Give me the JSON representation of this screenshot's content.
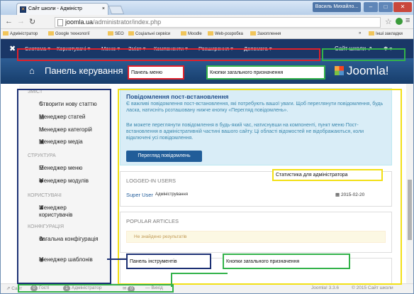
{
  "browser": {
    "tab_title": "Сайт школи - Адміністр",
    "tab_close": "×",
    "user_name": "Василь Михайло...",
    "url_host": "joomla.ua",
    "url_path": "/administrator/index.php",
    "bookmarks": [
      "Адміністратор",
      "Google технології",
      "SEO",
      "Соціальні сервіси",
      "Moodle",
      "Web-розробка",
      "Захоплення"
    ],
    "bookmarks_more": "»",
    "other_bookmarks": "Інші закладки"
  },
  "admin": {
    "menu_items": [
      "Система ▾",
      "Користувачі ▾",
      "Меню ▾",
      "Зміст ▾",
      "Компоненти ▾",
      "Розширення ▾",
      "Допомога ▾"
    ],
    "site_link": "Сайт школи ⇗",
    "gear": "✱ ▾",
    "page_title": "Панель керування",
    "brand": "Joomla!"
  },
  "sidebar": {
    "sections": [
      {
        "title": "ЗМІСТ",
        "items": [
          {
            "icon": "pencil-icon",
            "label": "Створити нову статтю"
          },
          {
            "icon": "stack-icon",
            "label": "Менеджер статей"
          },
          {
            "icon": "folder-icon",
            "label": "Менеджер категорій"
          },
          {
            "icon": "image-icon",
            "label": "Менеджер медіа"
          }
        ]
      },
      {
        "title": "СТРУКТУРА",
        "items": [
          {
            "icon": "list-icon",
            "label": "Менеджер меню"
          },
          {
            "icon": "cube-icon",
            "label": "Менеджер модулів"
          }
        ]
      },
      {
        "title": "КОРИСТУВАЧІ",
        "items": [
          {
            "icon": "users-icon",
            "label": "Менеджер користувачів"
          }
        ]
      },
      {
        "title": "КОНФІГУРАЦІЯ",
        "items": [
          {
            "icon": "cog-icon",
            "label": "Загальна конфігурація"
          },
          {
            "icon": "eye-icon",
            "label": "Менеджер шаблонів"
          }
        ]
      }
    ]
  },
  "main": {
    "alert_title": "Повідомлення пост-встановлення",
    "alert_p1": "Є важливі повідомлення пост-встановлення, які потребують вашої уваги. Щоб переглянути повідомлення, будь ласка, натисніть розташовану нижче кнопку «Перегляд повідомлень».",
    "alert_p2": "Ви можете переглянути повідомлення в будь-який час, натиснувши на компоненті, пункт меню Пост-встановлення в адміністративній частині вашого сайту. Ці області відомостей не відображаються, коли відключені усі повідомлення.",
    "alert_button": "Перегляд повідомлень",
    "logged_in_title": "LOGGED-IN USERS",
    "user_name": "Super User",
    "user_role": "Адміністрування",
    "user_date": "2015-02-20",
    "popular_title": "POPULAR ARTICLES",
    "no_results": "Не знайдено результатів",
    "recent_title": "RECENTLY ADDED ARTICLES"
  },
  "footer": {
    "site": "Сайт",
    "guest_count": "0",
    "guest": "Гості",
    "admin_count": "1",
    "admin": "Адміністратор",
    "msg_count": "0",
    "logout": "Вихід",
    "version": "Joomla! 3.3.6",
    "copyright": "© 2015 Сайт школи"
  },
  "annotations": {
    "menu_panel": "Панель меню",
    "general_buttons_top": "Кнопки загального призначення",
    "admin_stats": "Статистика для адміністратора",
    "toolbar_panel": "Панель інструментів",
    "general_buttons_bottom": "Кнопки загального призначення"
  },
  "colors": {
    "joomla_dark": "#1a3767",
    "red_annotation": "#e0202a",
    "green_annotation": "#33b24a",
    "yellow_annotation": "#f2e016",
    "navy_annotation": "#1b2f73"
  }
}
